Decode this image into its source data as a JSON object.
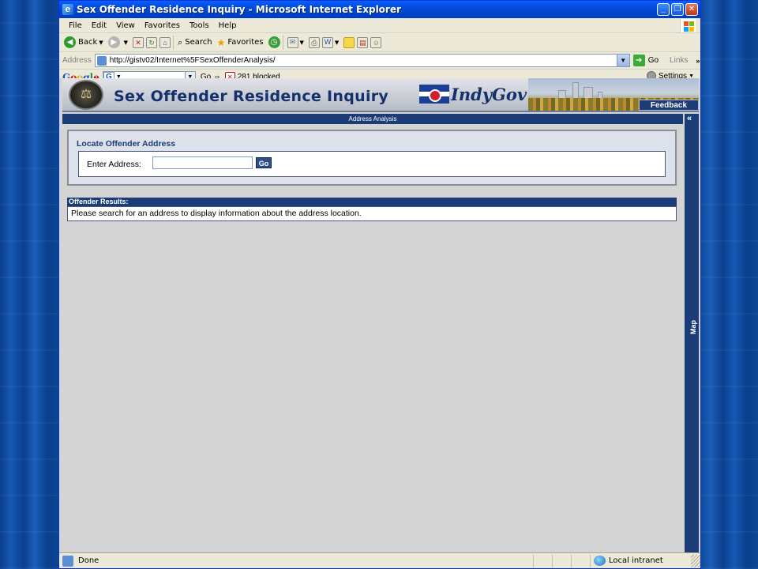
{
  "window": {
    "title": "Sex Offender Residence Inquiry - Microsoft Internet Explorer",
    "icon": "ie-icon",
    "controls": [
      "_",
      "❐",
      "✕"
    ]
  },
  "menu": {
    "items": [
      "File",
      "Edit",
      "View",
      "Favorites",
      "Tools",
      "Help"
    ]
  },
  "toolbar": {
    "back_label": "Back",
    "search_label": "Search",
    "favorites_label": "Favorites"
  },
  "address": {
    "label": "Address",
    "url": "http://gistv02/Internet%5FSexOffenderAnalysis/",
    "go_label": "Go",
    "links_label": "Links"
  },
  "google_bar": {
    "logo": "Google",
    "search_value": "",
    "go_label": "Go",
    "blocked_label": "281 blocked",
    "settings_label": "Settings"
  },
  "banner": {
    "title": "Sex Offender Residence Inquiry",
    "brand": "IndyGov",
    "feedback_label": "Feedback"
  },
  "main": {
    "section_title": "Address Analysis",
    "map_label": "Map",
    "collapse_label": "«",
    "locate": {
      "title": "Locate Offender Address",
      "input_label": "Enter Address:",
      "input_value": "",
      "go_label": "Go"
    },
    "results": {
      "header": "Offender Results:",
      "message": "Please search for an address to display information about the address location."
    }
  },
  "status": {
    "text": "Done",
    "zone": "Local intranet"
  },
  "colors": {
    "titlebar": "#0046d5",
    "navy": "#1c3c78",
    "content_bg": "#d4d4d4"
  }
}
